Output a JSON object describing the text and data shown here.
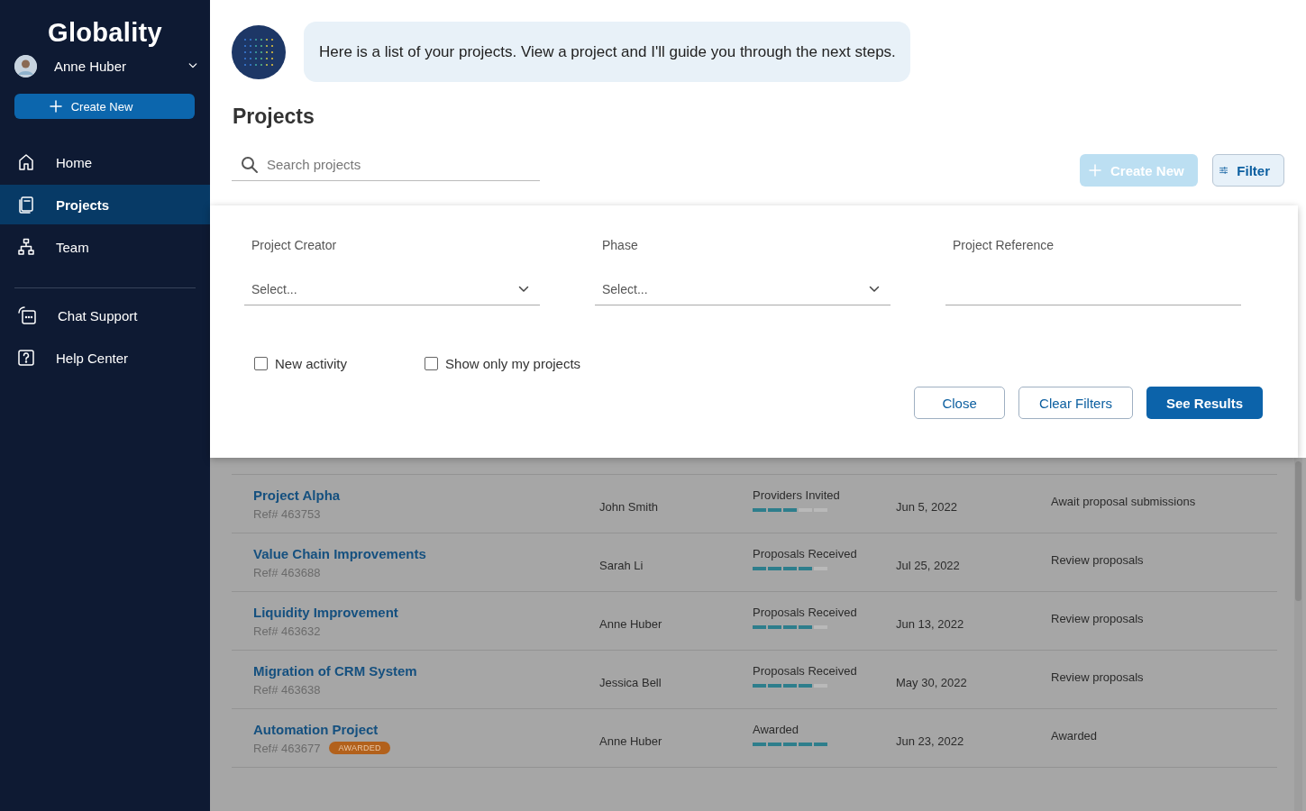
{
  "sidebar": {
    "logo": "Globality",
    "user": {
      "name": "Anne Huber"
    },
    "create_button": "Create New",
    "nav": [
      {
        "label": "Home",
        "kind": "home",
        "selected": false
      },
      {
        "label": "Projects",
        "kind": "projects",
        "selected": true
      },
      {
        "label": "Team",
        "kind": "team",
        "selected": false
      }
    ],
    "support": [
      {
        "label": "Chat Support",
        "kind": "chat"
      },
      {
        "label": "Help Center",
        "kind": "help"
      }
    ]
  },
  "assistant": {
    "message": "Here is a list of your projects. View a project and I'll guide you through the next steps."
  },
  "page": {
    "title": "Projects",
    "search": {
      "placeholder": "Search projects"
    },
    "create_button": {
      "label": "Create New",
      "disabled": true
    },
    "filter_button": {
      "label": "Filter",
      "selected": true
    }
  },
  "filter_panel": {
    "fields": [
      {
        "label": "Project Creator",
        "kind": "select",
        "placeholder": "Select..."
      },
      {
        "label": "Phase",
        "kind": "select",
        "placeholder": "Select..."
      },
      {
        "label": "Project Reference",
        "kind": "text"
      }
    ],
    "checkboxes": [
      {
        "label": "New activity",
        "checked": false
      },
      {
        "label": "Show only my projects",
        "checked": false
      }
    ],
    "buttons": [
      {
        "label": "Close",
        "kind": "secondary"
      },
      {
        "label": "Clear Filters",
        "kind": "secondary"
      },
      {
        "label": "See Results",
        "kind": "primary"
      }
    ]
  },
  "projects": [
    {
      "name": "Project Alpha",
      "ref": "Ref# 463753",
      "owner": "John Smith",
      "phase": "Providers Invited",
      "level": 0.6,
      "date": "Jun 5, 2022",
      "next_step": "Await proposal submissions"
    },
    {
      "name": "Value Chain Improvements",
      "ref": "Ref# 463688",
      "owner": "Sarah Li",
      "phase": "Proposals Received",
      "level": 0.8,
      "date": "Jul 25, 2022",
      "next_step": "Review proposals"
    },
    {
      "name": "Liquidity Improvement",
      "ref": "Ref# 463632",
      "owner": "Anne Huber",
      "phase": "Proposals Received",
      "level": 0.8,
      "date": "Jun 13, 2022",
      "next_step": "Review proposals"
    },
    {
      "name": "Migration of CRM System",
      "ref": "Ref# 463638",
      "owner": "Jessica Bell",
      "phase": "Proposals Received",
      "level": 0.8,
      "date": "May 30, 2022",
      "next_step": "Review proposals"
    },
    {
      "name": "Automation Project",
      "ref": "Ref# 463677",
      "badge": "AWARDED",
      "owner": "Anne Huber",
      "phase": "Awarded",
      "level": 1,
      "date": "Jun 23, 2022",
      "next_step": "Awarded"
    }
  ]
}
